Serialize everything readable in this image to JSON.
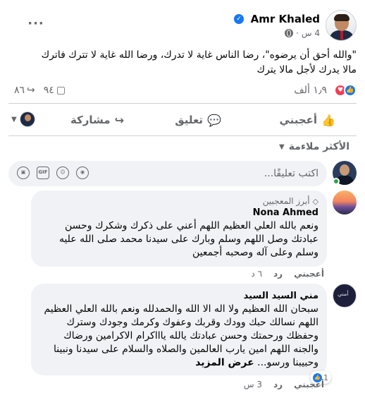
{
  "post": {
    "author": "Amr Khaled",
    "time": "4 س",
    "text_line1": "\"والله أحق أن يرضوه\"، رضا الناس غاية لا تدرك، ورضا الله غاية لا تترك فاترك",
    "text_line2": "مالا يدرك لأجل مالا يترك"
  },
  "reactions": {
    "summary": "١٫٩ ألف",
    "comments_count": "٩٤",
    "shares_count": "٨٦"
  },
  "actions": {
    "like": "أعجبني",
    "comment": "تعليق",
    "share": "مشاركة"
  },
  "sort": {
    "label": "الأكثر ملاءمة"
  },
  "composer": {
    "placeholder": "اكتب تعليقًا...",
    "gif_label": "GIF"
  },
  "comments": [
    {
      "badge": "أبرز المعجبين",
      "name": "Nona Ahmed",
      "text": "ونعم بالله العلي العظيم اللهم أعني على ذكرك وشكرك وحسن عبادتك وصل اللهم وسلم وبارك على سيدنا محمد صلى الله عليه وسلم وعلى آله وصحبه أجمعين",
      "like_label": "أعجبني",
      "reply_label": "رد",
      "time": "٦ د"
    },
    {
      "name": "مني السيد السيد",
      "text": "سبحان الله العظيم ولا اله الا الله والحمدلله ونعم بالله العلي العظيم اللهم نسالك حبك وودك وقربك وعفوك وكرمك وجودك وسترك وحفظك ورحمتك وحسن عبادتك يالله ياااكرام الاكرامين ورضاك والجنه اللهم امين يارب العالمين والصلاه والسلام على سيدنا ونبينا وحبيبنا ورسو...",
      "see_more": "عرض المزيد",
      "like_label": "أعجبني",
      "reply_label": "رد",
      "time": "3 س",
      "reaction_count": "1"
    }
  ],
  "icons": {
    "verified": "verified-badge-icon",
    "globe": "globe-icon",
    "more": "more-options-icon",
    "like_reaction": "like-reaction-icon",
    "love_reaction": "love-reaction-icon",
    "comment": "comment-icon",
    "share": "share-icon",
    "like": "thumbs-up-icon"
  },
  "colors": {
    "accent": "#1877f2",
    "love": "#f33e58",
    "secondary_text": "#65676b",
    "bubble_bg": "#f0f2f5"
  }
}
